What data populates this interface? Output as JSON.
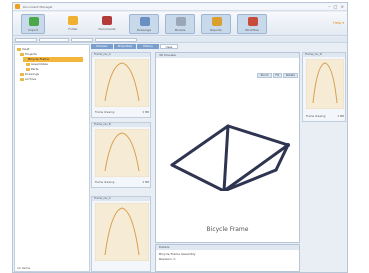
{
  "window": {
    "title": "Document Manager",
    "controls": "– □ ×"
  },
  "ribbon": {
    "buttons": [
      {
        "label": "Import",
        "icon": "import-icon",
        "color": "#4aa84a"
      },
      {
        "label": "Folder",
        "icon": "folder-icon",
        "color": "#f0b030"
      },
      {
        "label": "Documents",
        "icon": "documents-icon",
        "color": "#b33b3b"
      },
      {
        "label": "Drawings",
        "icon": "drawings-icon",
        "color": "#6b8fc2"
      },
      {
        "label": "Models",
        "icon": "models-icon",
        "color": "#9aa7b8"
      },
      {
        "label": "Reports",
        "icon": "reports-icon",
        "color": "#d9a030"
      },
      {
        "label": "Workflow",
        "icon": "workflow-icon",
        "color": "#c84a3a"
      }
    ],
    "help": "Help ▾"
  },
  "tree": {
    "items": [
      "Vault",
      "Projects",
      "Bicycle Frame",
      "Assemblies",
      "Parts",
      "Drawings",
      "Archive"
    ],
    "status": "12 items"
  },
  "tabs": [
    "Preview",
    "Properties",
    "History",
    "Uses"
  ],
  "thumbnails": [
    {
      "title": "Frame_rev_A",
      "size": "2 MB",
      "name": "Frame drawing"
    },
    {
      "title": "Frame_rev_B",
      "size": "2 MB",
      "name": "Frame drawing"
    },
    {
      "title": "Frame_rev_C",
      "size": "2 MB",
      "name": "Frame drawing"
    },
    {
      "title": "Frame_rev_D",
      "size": "2 MB",
      "name": "Frame drawing"
    }
  ],
  "viewer": {
    "title": "3D Preview",
    "buttons": [
      "Zoom",
      "Fit",
      "Rotate"
    ],
    "caption": "Bicycle Frame"
  },
  "info": {
    "title": "Details",
    "lines": [
      "Bicycle Frame Assembly",
      "Revision: C"
    ]
  }
}
